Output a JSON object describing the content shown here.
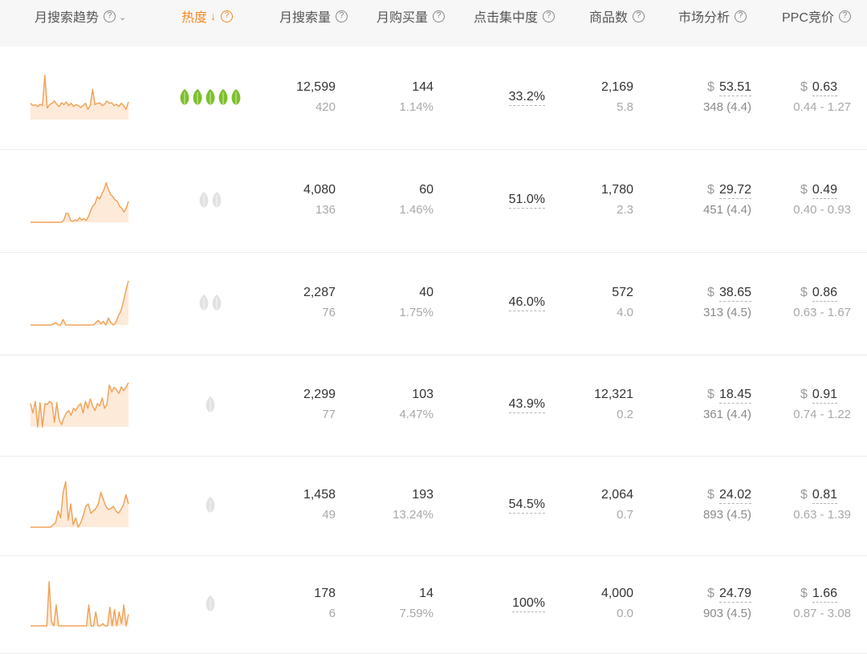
{
  "headers": {
    "trend": "月搜索趋势",
    "heat": "热度",
    "monthly_search": "月搜索量",
    "monthly_purchase": "月购买量",
    "click_concentration": "点击集中度",
    "product_count": "商品数",
    "market_analysis": "市场分析",
    "ppc_bid": "PPC竞价"
  },
  "icons": {
    "help": "question-circle-icon",
    "dropdown": "chevron-down-icon",
    "sort": "arrow-down-icon",
    "heat": "leaf-icon"
  },
  "colors": {
    "accent": "#f08a24",
    "leaf_active": "#7cc02a",
    "leaf_inactive": "#e2e2e2"
  },
  "rows": [
    {
      "heat_level": 5,
      "heat_active": true,
      "search": "12,599",
      "search_sub": "420",
      "purchase": "144",
      "purchase_rate": "1.14%",
      "click_concentration": "33.2%",
      "products": "2,169",
      "products_sub": "5.8",
      "currency": "$",
      "price": "53.51",
      "reviews": "348 (4.4)",
      "ppc": "0.63",
      "ppc_range": "0.44 - 1.27"
    },
    {
      "heat_level": 2,
      "heat_active": false,
      "search": "4,080",
      "search_sub": "136",
      "purchase": "60",
      "purchase_rate": "1.46%",
      "click_concentration": "51.0%",
      "products": "1,780",
      "products_sub": "2.3",
      "currency": "$",
      "price": "29.72",
      "reviews": "451 (4.4)",
      "ppc": "0.49",
      "ppc_range": "0.40 - 0.93"
    },
    {
      "heat_level": 2,
      "heat_active": false,
      "search": "2,287",
      "search_sub": "76",
      "purchase": "40",
      "purchase_rate": "1.75%",
      "click_concentration": "46.0%",
      "products": "572",
      "products_sub": "4.0",
      "currency": "$",
      "price": "38.65",
      "reviews": "313 (4.5)",
      "ppc": "0.86",
      "ppc_range": "0.63 - 1.67"
    },
    {
      "heat_level": 1,
      "heat_active": false,
      "search": "2,299",
      "search_sub": "77",
      "purchase": "103",
      "purchase_rate": "4.47%",
      "click_concentration": "43.9%",
      "products": "12,321",
      "products_sub": "0.2",
      "currency": "$",
      "price": "18.45",
      "reviews": "361 (4.4)",
      "ppc": "0.91",
      "ppc_range": "0.74 - 1.22"
    },
    {
      "heat_level": 1,
      "heat_active": false,
      "search": "1,458",
      "search_sub": "49",
      "purchase": "193",
      "purchase_rate": "13.24%",
      "click_concentration": "54.5%",
      "products": "2,064",
      "products_sub": "0.7",
      "currency": "$",
      "price": "24.02",
      "reviews": "893 (4.5)",
      "ppc": "0.81",
      "ppc_range": "0.63 - 1.39"
    },
    {
      "heat_level": 1,
      "heat_active": false,
      "search": "178",
      "search_sub": "6",
      "purchase": "14",
      "purchase_rate": "7.59%",
      "click_concentration": "100%",
      "products": "4,000",
      "products_sub": "0.0",
      "currency": "$",
      "price": "24.79",
      "reviews": "903 (4.5)",
      "ppc": "1.66",
      "ppc_range": "0.87 - 3.08"
    }
  ],
  "trends": [
    [
      0.35,
      0.3,
      0.32,
      0.28,
      0.33,
      0.3,
      0.95,
      0.25,
      0.32,
      0.35,
      0.4,
      0.33,
      0.28,
      0.36,
      0.32,
      0.38,
      0.3,
      0.35,
      0.28,
      0.32,
      0.3,
      0.26,
      0.3,
      0.35,
      0.22,
      0.3,
      0.65,
      0.32,
      0.35,
      0.36,
      0.3,
      0.33,
      0.4,
      0.35,
      0.36,
      0.3,
      0.33,
      0.28,
      0.35,
      0.3,
      0.22,
      0.38
    ],
    [
      0,
      0,
      0,
      0,
      0,
      0,
      0,
      0,
      0,
      0,
      0,
      0,
      0,
      0,
      0,
      0.05,
      0.2,
      0.18,
      0.04,
      0.02,
      0.05,
      0.03,
      0.1,
      0.05,
      0.08,
      0.04,
      0.12,
      0.25,
      0.35,
      0.4,
      0.55,
      0.5,
      0.6,
      0.7,
      0.85,
      0.7,
      0.6,
      0.55,
      0.48,
      0.45,
      0.35,
      0.3,
      0.22,
      0.3,
      0.45
    ],
    [
      0,
      0,
      0,
      0,
      0,
      0,
      0,
      0,
      0,
      0.02,
      0.05,
      0,
      0,
      0.12,
      0,
      0,
      0,
      0,
      0,
      0,
      0,
      0,
      0,
      0,
      0,
      0,
      0.05,
      0.1,
      0.03,
      0.08,
      0,
      0.15,
      0.05,
      0,
      0.06,
      0.2,
      0.3,
      0.5,
      0.75,
      0.95
    ],
    [
      0.5,
      0.3,
      0.55,
      0,
      0.52,
      0,
      0.5,
      0.48,
      0.55,
      0.5,
      0.1,
      0.52,
      0.15,
      0.05,
      0.2,
      0.3,
      0.35,
      0.25,
      0.4,
      0.35,
      0.45,
      0.5,
      0.3,
      0.55,
      0.4,
      0.6,
      0.45,
      0.35,
      0.5,
      0.45,
      0.62,
      0.4,
      0.48,
      0.9,
      0.75,
      0.85,
      0.8,
      0.72,
      0.86,
      0.78,
      0.85,
      0.95
    ],
    [
      0,
      0,
      0,
      0,
      0,
      0,
      0,
      0,
      0,
      0.05,
      0.1,
      0.35,
      0.2,
      0.75,
      0.98,
      0.15,
      0.5,
      0.05,
      0.2,
      0,
      0.1,
      0.25,
      0.45,
      0.5,
      0.3,
      0.35,
      0.4,
      0.5,
      0.75,
      0.6,
      0.45,
      0.38,
      0.4,
      0.45,
      0.35,
      0.3,
      0.38,
      0.48,
      0.7,
      0.5
    ],
    [
      0,
      0,
      0,
      0,
      0,
      0,
      0,
      0,
      0.95,
      0.1,
      0,
      0.45,
      0,
      0,
      0,
      0,
      0,
      0,
      0,
      0,
      0,
      0,
      0,
      0,
      0,
      0.45,
      0,
      0,
      0.3,
      0,
      0,
      0.05,
      0,
      0,
      0.4,
      0,
      0.35,
      0,
      0.3,
      0.05,
      0.45,
      0,
      0.25
    ]
  ]
}
